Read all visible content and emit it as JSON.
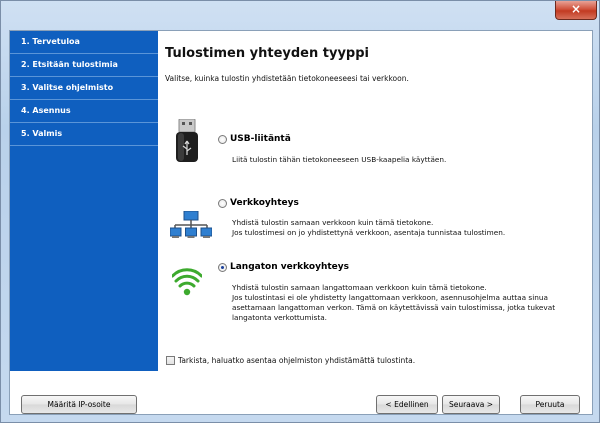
{
  "window": {
    "close_glyph": "×"
  },
  "sidebar": {
    "items": [
      {
        "label": "1. Tervetuloa"
      },
      {
        "label": "2. Etsitään tulostimia"
      },
      {
        "label": "3. Valitse ohjelmisto"
      },
      {
        "label": "4. Asennus"
      },
      {
        "label": "5. Valmis"
      }
    ]
  },
  "main": {
    "title": "Tulostimen yhteyden tyyppi",
    "description": "Valitse, kuinka tulostin yhdistetään tietokoneeseesi tai verkkoon.",
    "options": [
      {
        "label": "USB-liitäntä",
        "selected": false,
        "icon": "usb-icon",
        "lines": [
          "Liitä tulostin tähän tietokoneeseen USB-kaapelia käyttäen."
        ]
      },
      {
        "label": "Verkkoyhteys",
        "selected": false,
        "icon": "network-icon",
        "lines": [
          "Yhdistä tulostin samaan verkkoon kuin tämä tietokone.",
          "Jos tulostimesi on jo yhdistettynä verkkoon, asentaja tunnistaa tulostimen."
        ]
      },
      {
        "label": "Langaton verkkoyhteys",
        "selected": true,
        "icon": "wireless-icon",
        "lines": [
          "Yhdistä tulostin samaan langattomaan verkkoon kuin tämä tietokone.",
          "Jos tulostintasi ei ole yhdistetty langattomaan verkkoon, asennusohjelma auttaa sinua",
          "asettamaan langattoman verkon. Tämä on käytettävissä vain tulostimissa, jotka tukevat",
          "langatonta verkottumista."
        ]
      }
    ],
    "checkbox_label": "Tarkista, haluatko asentaa ohjelmiston yhdistämättä tulostinta."
  },
  "buttons": {
    "ip": "Määritä IP-osoite",
    "back": "< Edellinen",
    "next": "Seuraava >",
    "cancel": "Peruuta"
  },
  "colors": {
    "sidebar": "#0f5fbf",
    "wifi": "#3daa2e"
  }
}
